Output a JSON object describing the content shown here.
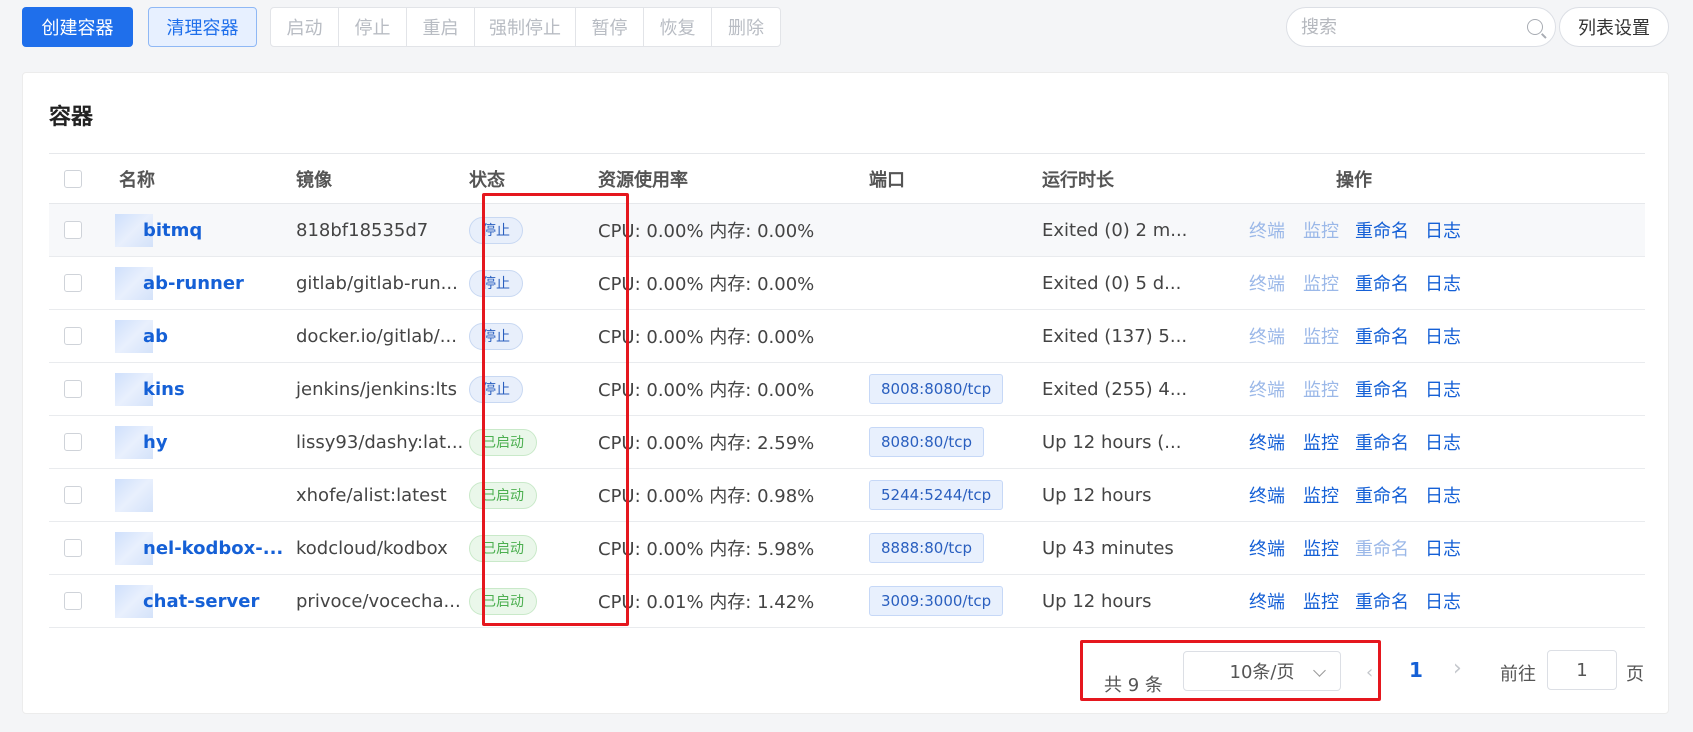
{
  "toolbar": {
    "create_label": "创建容器",
    "clean_label": "清理容器",
    "actions": [
      {
        "label": "启动",
        "width": 68
      },
      {
        "label": "停止",
        "width": 68
      },
      {
        "label": "重启",
        "width": 68
      },
      {
        "label": "强制停止",
        "width": 101
      },
      {
        "label": "暂停",
        "width": 68
      },
      {
        "label": "恢复",
        "width": 68
      },
      {
        "label": "删除",
        "width": 68
      }
    ],
    "search_placeholder": "搜索",
    "list_settings_label": "列表设置"
  },
  "card": {
    "title": "容器"
  },
  "table": {
    "headers": {
      "name": "名称",
      "image": "镜像",
      "status": "状态",
      "resource": "资源使用率",
      "port": "端口",
      "uptime": "运行时长",
      "actions": "操作"
    },
    "action_labels": {
      "terminal": "终端",
      "monitor": "监控",
      "rename": "重命名",
      "logs": "日志"
    },
    "rows": [
      {
        "name": "bitmq",
        "image": "818bf18535d7",
        "status": "停止",
        "state": "stopped",
        "resource": "CPU: 0.00% 内存: 0.00%",
        "port": "",
        "uptime": "Exited (0) 2 m...",
        "terminal_enabled": false,
        "monitor_enabled": false,
        "rename_enabled": true
      },
      {
        "name": "ab-runner",
        "image": "gitlab/gitlab-run...",
        "status": "停止",
        "state": "stopped",
        "resource": "CPU: 0.00% 内存: 0.00%",
        "port": "",
        "uptime": "Exited (0) 5 d...",
        "terminal_enabled": false,
        "monitor_enabled": false,
        "rename_enabled": true
      },
      {
        "name": "ab",
        "image": "docker.io/gitlab/...",
        "status": "停止",
        "state": "stopped",
        "resource": "CPU: 0.00% 内存: 0.00%",
        "port": "",
        "uptime": "Exited (137) 5...",
        "terminal_enabled": false,
        "monitor_enabled": false,
        "rename_enabled": true
      },
      {
        "name": "kins",
        "image": "jenkins/jenkins:lts",
        "status": "停止",
        "state": "stopped",
        "resource": "CPU: 0.00% 内存: 0.00%",
        "port": "8008:8080/tcp",
        "uptime": "Exited (255) 4...",
        "terminal_enabled": false,
        "monitor_enabled": false,
        "rename_enabled": true
      },
      {
        "name": "hy",
        "image": "lissy93/dashy:lat...",
        "status": "已启动",
        "state": "running",
        "resource": "CPU: 0.00% 内存: 2.59%",
        "port": "8080:80/tcp",
        "uptime": "Up 12 hours (...",
        "terminal_enabled": true,
        "monitor_enabled": true,
        "rename_enabled": true
      },
      {
        "name": "",
        "image": "xhofe/alist:latest",
        "status": "已启动",
        "state": "running",
        "resource": "CPU: 0.00% 内存: 0.98%",
        "port": "5244:5244/tcp",
        "uptime": "Up 12 hours",
        "terminal_enabled": true,
        "monitor_enabled": true,
        "rename_enabled": true
      },
      {
        "name": "nel-kodbox-...",
        "image": "kodcloud/kodbox",
        "status": "已启动",
        "state": "running",
        "resource": "CPU: 0.00% 内存: 5.98%",
        "port": "8888:80/tcp",
        "uptime": "Up 43 minutes",
        "terminal_enabled": true,
        "monitor_enabled": true,
        "rename_enabled": false
      },
      {
        "name": "chat-server",
        "image": "privoce/vocecha...",
        "status": "已启动",
        "state": "running",
        "resource": "CPU: 0.01% 内存: 1.42%",
        "port": "3009:3000/tcp",
        "uptime": "Up 12 hours",
        "terminal_enabled": true,
        "monitor_enabled": true,
        "rename_enabled": true
      }
    ]
  },
  "pagination": {
    "total": "共 9 条",
    "page_size": "10条/页",
    "current_page": "1",
    "goto_label": "前往",
    "goto_value": "1",
    "goto_suffix": "页"
  },
  "colors": {
    "primary": "#1f6feb",
    "link": "#1560d6",
    "highlight": "#e5171e",
    "running": "#4caf50"
  }
}
